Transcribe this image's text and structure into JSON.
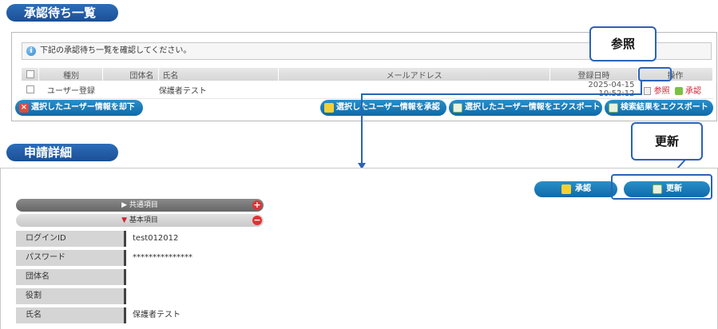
{
  "approval_section": {
    "title": "承認待ち一覧",
    "info_text": "下記の承認待ち一覧を確認してください。",
    "columns": [
      "種別",
      "団体名",
      "氏名",
      "メールアドレス",
      "登録日時",
      "操作"
    ],
    "rows": [
      {
        "type": "ユーザー登録",
        "group": "",
        "name": "保護者テスト",
        "email": "",
        "registered": "2025-04-15 10:52:12",
        "ref_label": "参照",
        "approve_label": "承認"
      }
    ],
    "buttons": {
      "reject": "選択したユーザー情報を却下",
      "approve": "選択したユーザー情報を承認",
      "export_selected": "選択したユーザー情報をエクスポート",
      "export_results": "検索結果をエクスポート"
    }
  },
  "detail_section": {
    "title": "申請詳細",
    "approve_button": "承認",
    "update_button": "更新",
    "groups": {
      "common": "共通項目",
      "basic": "基本項目"
    },
    "fields": [
      {
        "label": "ログインID",
        "value": "test012012"
      },
      {
        "label": "パスワード",
        "value": "***************"
      },
      {
        "label": "団体名",
        "value": ""
      },
      {
        "label": "役割",
        "value": ""
      },
      {
        "label": "氏名",
        "value": "保護者テスト"
      }
    ]
  },
  "callouts": {
    "reference": "参照",
    "update": "更新"
  },
  "colors": {
    "accent": "#2a63b8",
    "button_blue": "#1a7bbd",
    "link_red": "#cc2233"
  }
}
